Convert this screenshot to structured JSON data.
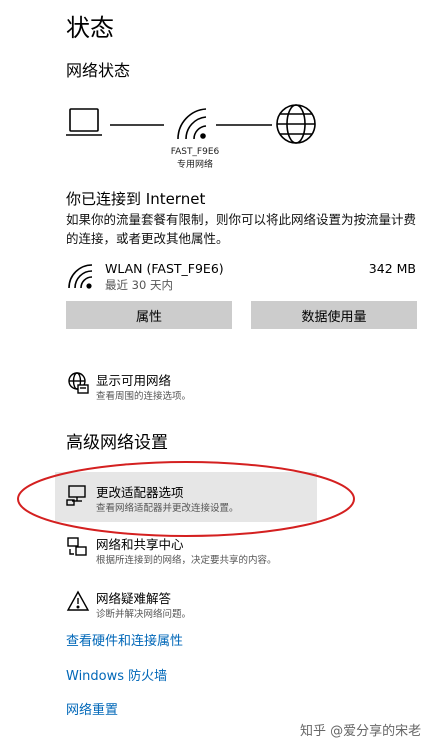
{
  "header": {
    "title": "状态",
    "subtitle": "网络状态"
  },
  "network_diagram": {
    "ssid": "FAST_F9E6",
    "type": "专用网络",
    "icons": [
      "laptop-icon",
      "wifi-icon",
      "globe-icon"
    ]
  },
  "connection": {
    "title": "你已连接到 Internet",
    "description": "如果你的流量套餐有限制，则你可以将此网络设置为按流量计费的连接，或者更改其他属性。"
  },
  "adapter": {
    "name": "WLAN (FAST_F9E6)",
    "sub": "最近 30 天内",
    "usage": "342 MB",
    "properties_label": "属性",
    "data_usage_label": "数据使用量"
  },
  "show_networks": {
    "title": "显示可用网络",
    "desc": "查看周围的连接选项。"
  },
  "advanced": {
    "title": "高级网络设置",
    "items": [
      {
        "title": "更改适配器选项",
        "desc": "查看网络适配器并更改连接设置。",
        "icon": "adapter-icon"
      },
      {
        "title": "网络和共享中心",
        "desc": "根据所连接到的网络，决定要共享的内容。",
        "icon": "sharing-icon"
      },
      {
        "title": "网络疑难解答",
        "desc": "诊断并解决网络问题。",
        "icon": "warning-icon"
      }
    ]
  },
  "links": [
    "查看硬件和连接属性",
    "Windows 防火墙",
    "网络重置"
  ],
  "watermark": "知乎 @爱分享的宋老",
  "colors": {
    "link": "#0067b8",
    "highlight": "#e6e6e6",
    "button": "#cccccc",
    "annotation": "#d42020"
  }
}
